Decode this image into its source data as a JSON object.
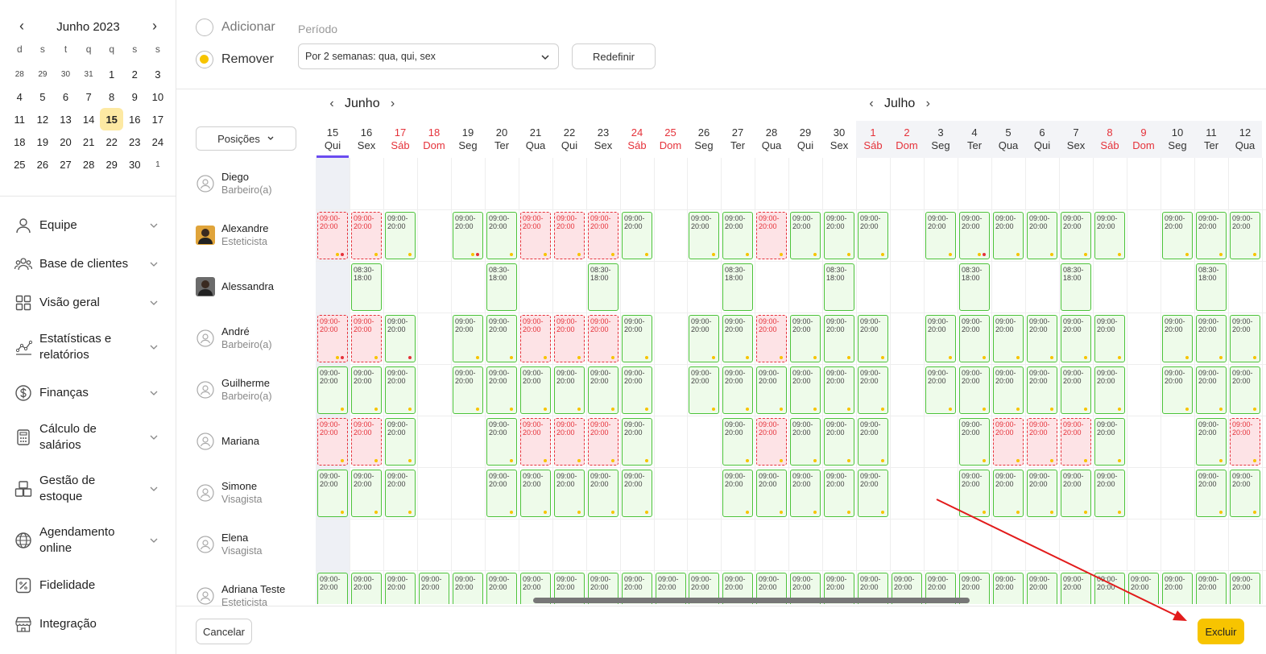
{
  "mini_calendar": {
    "title": "Junho 2023",
    "weekdays": [
      "d",
      "s",
      "t",
      "q",
      "q",
      "s",
      "s"
    ],
    "weeks": [
      [
        "28",
        "29",
        "30",
        "31",
        "1",
        "2",
        "3"
      ],
      [
        "4",
        "5",
        "6",
        "7",
        "8",
        "9",
        "10"
      ],
      [
        "11",
        "12",
        "13",
        "14",
        "15",
        "16",
        "17"
      ],
      [
        "18",
        "19",
        "20",
        "21",
        "22",
        "23",
        "24"
      ],
      [
        "25",
        "26",
        "27",
        "28",
        "29",
        "30",
        "1"
      ]
    ],
    "selected": "15"
  },
  "nav": [
    {
      "label": "Equipe",
      "icon": "user-icon"
    },
    {
      "label": "Base de clientes",
      "icon": "users-icon"
    },
    {
      "label": "Visão geral",
      "icon": "grid-icon"
    },
    {
      "label": "Estatísticas e relatórios",
      "icon": "chart-icon"
    },
    {
      "label": "Finanças",
      "icon": "dollar-icon"
    },
    {
      "label": "Cálculo de salários",
      "icon": "calculator-icon"
    },
    {
      "label": "Gestão de estoque",
      "icon": "boxes-icon"
    },
    {
      "label": "Agendamento online",
      "icon": "globe-icon"
    },
    {
      "label": "Fidelidade",
      "icon": "percent-icon"
    },
    {
      "label": "Integração",
      "icon": "store-icon"
    }
  ],
  "mode": {
    "add_label": "Adicionar",
    "remove_label": "Remover",
    "selected": "remove"
  },
  "period": {
    "label": "Período",
    "value": "Por 2 semanas: qua, qui, sex"
  },
  "reset_label": "Redefinir",
  "positions_label": "Posições",
  "months": [
    {
      "title": "Junho"
    },
    {
      "title": "Julho"
    }
  ],
  "days": [
    {
      "num": "15",
      "dow": "Qui"
    },
    {
      "num": "16",
      "dow": "Sex"
    },
    {
      "num": "17",
      "dow": "Sáb"
    },
    {
      "num": "18",
      "dow": "Dom"
    },
    {
      "num": "19",
      "dow": "Seg"
    },
    {
      "num": "20",
      "dow": "Ter"
    },
    {
      "num": "21",
      "dow": "Qua"
    },
    {
      "num": "22",
      "dow": "Qui"
    },
    {
      "num": "23",
      "dow": "Sex"
    },
    {
      "num": "24",
      "dow": "Sáb"
    },
    {
      "num": "25",
      "dow": "Dom"
    },
    {
      "num": "26",
      "dow": "Seg"
    },
    {
      "num": "27",
      "dow": "Ter"
    },
    {
      "num": "28",
      "dow": "Qua"
    },
    {
      "num": "29",
      "dow": "Qui"
    },
    {
      "num": "30",
      "dow": "Sex"
    },
    {
      "num": "1",
      "dow": "Sáb"
    },
    {
      "num": "2",
      "dow": "Dom"
    },
    {
      "num": "3",
      "dow": "Seg"
    },
    {
      "num": "4",
      "dow": "Ter"
    },
    {
      "num": "5",
      "dow": "Qua"
    },
    {
      "num": "6",
      "dow": "Qui"
    },
    {
      "num": "7",
      "dow": "Sex"
    },
    {
      "num": "8",
      "dow": "Sáb"
    },
    {
      "num": "9",
      "dow": "Dom"
    },
    {
      "num": "10",
      "dow": "Seg"
    },
    {
      "num": "11",
      "dow": "Ter"
    },
    {
      "num": "12",
      "dow": "Qua"
    }
  ],
  "staff": [
    {
      "name": "Diego",
      "role": "Barbeiro(a)",
      "avatar": "default-avatar-icon",
      "green": "",
      "red": "",
      "dots": ""
    },
    {
      "name": "Alexandre",
      "role": "Esteticista",
      "avatar": "photo-avatar",
      "green": "2,4,5,9,11,12,14,15,16,18,19,20,21,22,23,25,26,27",
      "red": "0,1,6,7,8,13",
      "dots": "0:yr,1:y,2:y,4:yr,5:y,6:y,7:y,8:y,9:y,11:y,12:y,13:y,14:y,15:y,16:y,18:y,19:yr,20:y,21:y,22:y,23:y,25:y,26:y,27:y"
    },
    {
      "name": "Alessandra",
      "role": "",
      "avatar": "photo-avatar",
      "green": "1,5,8,12,15,19,22,26",
      "red": "",
      "dots": ""
    },
    {
      "name": "André",
      "role": "Barbeiro(a)",
      "avatar": "default-avatar-icon",
      "green": "2,4,5,9,11,12,14,15,16,18,19,20,21,22,23,25,26,27",
      "red": "0,1,6,7,8,13",
      "dots": "0:yr,1:y,2:r,4:y,5:y,6:y,7:y,8:y,9:y,11:y,12:y,13:y,14:y,15:y,16:y,18:y,19:y,20:y,21:y,22:y,23:y,25:y,26:y,27:y"
    },
    {
      "name": "Guilherme",
      "role": "Barbeiro(a)",
      "avatar": "default-avatar-icon",
      "green": "0,1,2,4,5,6,7,8,9,11,12,13,14,15,16,18,19,20,21,22,23,25,26,27",
      "red": "",
      "dots": "0:y,1:y,2:y,4:y,5:y,6:y,7:y,8:y,9:y,11:y,12:y,13:y,14:y,15:y,16:y,18:y,19:y,20:y,21:y,22:y,23:y,25:y,26:y,27:y"
    },
    {
      "name": "Mariana",
      "role": "",
      "avatar": "default-avatar-icon",
      "green": "2,5,9,12,14,15,16,19,23,26",
      "red": "0,1,6,7,8,13,20,21,22,27",
      "dots": "0:y,1:y,2:y,5:y,6:y,7:y,8:y,9:y,12:y,13:y,14:y,15:y,16:y,19:y,20:y,21:y,22:y,23:y,26:y,27:y"
    },
    {
      "name": "Simone",
      "role": "Visagista",
      "avatar": "default-avatar-icon",
      "green": "0,1,2,5,6,7,8,9,12,13,14,15,16,19,20,21,22,23,26,27",
      "red": "",
      "dots": "0:y,1:y,2:y,5:y,6:y,7:y,8:y,9:y,12:y,13:y,14:y,15:y,16:y,19:y,20:y,21:y,22:y,23:y,26:y,27:y"
    },
    {
      "name": "Elena",
      "role": "Visagista",
      "avatar": "default-avatar-icon",
      "green": "",
      "red": "",
      "dots": ""
    },
    {
      "name": "Adriana Teste",
      "role": "Esteticista",
      "avatar": "default-avatar-icon",
      "green": "0,1,2,3,4,5,6,7,8,9,10,11,12,13,14,15,16,17,18,19,20,21,22,23,24,25,26,27",
      "red": "",
      "dots": ""
    }
  ],
  "cell_text": {
    "full": "09:00-\n20:00",
    "short": "08:30-\n18:00"
  },
  "cancel_label": "Cancelar",
  "delete_label": "Excluir",
  "colors": {
    "accent": "#f7c400",
    "work": "#4cc23a",
    "removed": "#e5323a",
    "today": "#6a4cf0"
  }
}
